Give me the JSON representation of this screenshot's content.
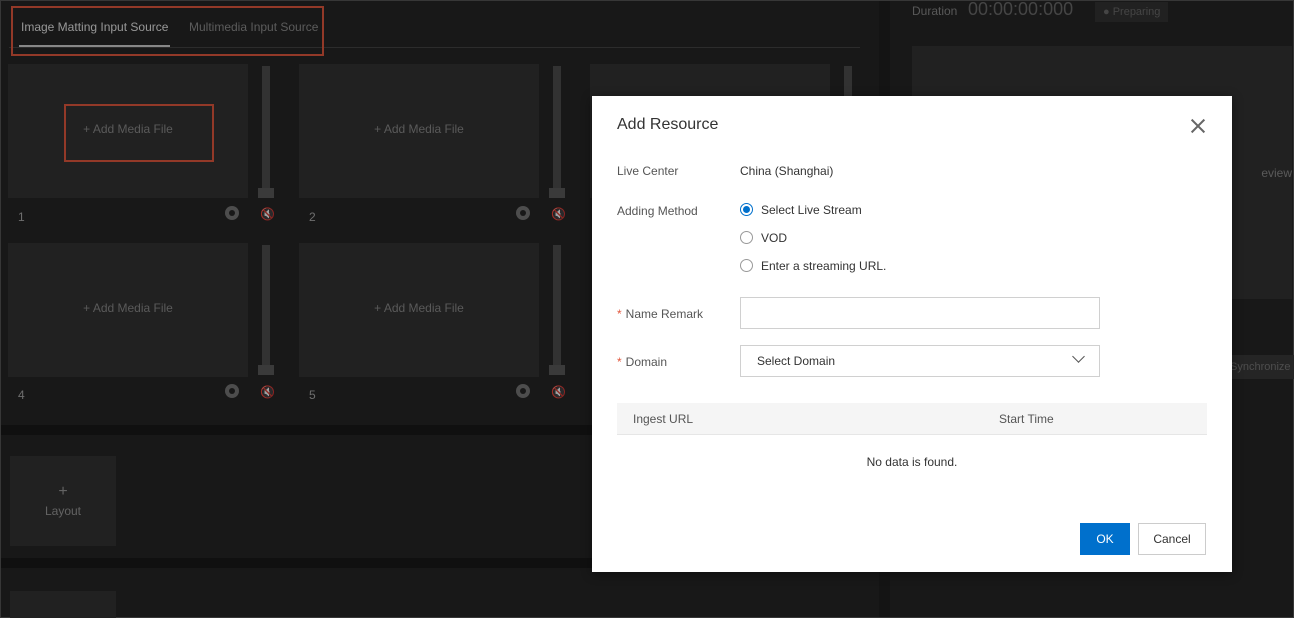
{
  "tabs": [
    {
      "label": "Image Matting Input Source",
      "active": true
    },
    {
      "label": "Multimedia Input Source",
      "active": false
    }
  ],
  "tiles": [
    {
      "add_label": "+ Add Media File",
      "number": "1"
    },
    {
      "add_label": "+ Add Media File",
      "number": "2"
    },
    {
      "add_label": "",
      "number": ""
    },
    {
      "add_label": "+ Add Media File",
      "number": "4"
    },
    {
      "add_label": "+ Add Media File",
      "number": "5"
    }
  ],
  "layout": {
    "plus": "+",
    "label": "Layout"
  },
  "right_panel": {
    "duration_label": "Duration",
    "duration_value": "00:00:00:000",
    "status": "● Preparing",
    "preview_text": "eview",
    "sync_label": "Synchronize"
  },
  "dialog": {
    "title": "Add Resource",
    "live_center_label": "Live Center",
    "live_center_value": "China (Shanghai)",
    "adding_method_label": "Adding Method",
    "adding_methods": [
      {
        "label": "Select Live Stream",
        "checked": true
      },
      {
        "label": "VOD",
        "checked": false
      },
      {
        "label": "Enter a streaming URL.",
        "checked": false
      }
    ],
    "name_remark_label": "Name Remark",
    "name_remark_value": "",
    "domain_label": "Domain",
    "domain_placeholder": "Select Domain",
    "required_mark": "*",
    "table": {
      "columns": [
        "Ingest URL",
        "Start Time"
      ],
      "empty_text": "No data is found."
    },
    "ok_label": "OK",
    "cancel_label": "Cancel"
  },
  "colors": {
    "accent": "#0070cc",
    "highlight": "#e2583e",
    "background": "#1f1f1f",
    "tile": "#333333"
  }
}
